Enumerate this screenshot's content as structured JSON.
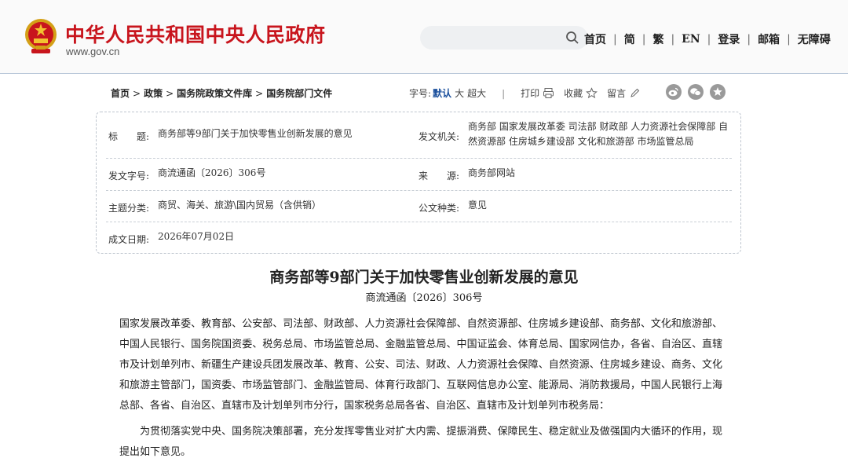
{
  "header": {
    "site_title": "中华人民共和国中央人民政府",
    "site_url": "www.gov.cn",
    "nav": [
      "首页",
      "简",
      "繁",
      "EN",
      "登录",
      "邮箱",
      "无障碍"
    ]
  },
  "breadcrumb": {
    "items": [
      "首页",
      "政策",
      "国务院政策文件库",
      "国务院部门文件"
    ],
    "separator": ">"
  },
  "tools": {
    "font_label": "字号:",
    "font_options": [
      "默认",
      "大",
      "超大"
    ],
    "print": "打印",
    "favorite": "收藏",
    "comment": "留言"
  },
  "info": {
    "title_label": "标　　题:",
    "title_value": "商务部等9部门关于加快零售业创新发展的意见",
    "issuer_label": "发文机关:",
    "issuer_value": "商务部 国家发展改革委 司法部 财政部 人力资源社会保障部 自然资源部 住房城乡建设部 文化和旅游部 市场监管总局",
    "docno_label": "发文字号:",
    "docno_value": "商流通函〔2026〕306号",
    "source_label": "来　　源:",
    "source_value": "商务部网站",
    "topic_label": "主题分类:",
    "topic_value": "商贸、海关、旅游\\国内贸易（含供销）",
    "doctype_label": "公文种类:",
    "doctype_value": "意见",
    "date_label": "成文日期:",
    "date_value": "2026年07月02日"
  },
  "article": {
    "title": "商务部等9部门关于加快零售业创新发展的意见",
    "docno": "商流通函〔2026〕306号",
    "addressees": "国家发展改革委、教育部、公安部、司法部、财政部、人力资源社会保障部、自然资源部、住房城乡建设部、商务部、文化和旅游部、中国人民银行、国务院国资委、税务总局、市场监管总局、金融监管总局、中国证监会、体育总局、国家网信办，各省、自治区、直辖市及计划单列市、新疆生产建设兵团发展改革、教育、公安、司法、财政、人力资源社会保障、自然资源、住房城乡建设、商务、文化和旅游主管部门，国资委、市场监管部门、金融监管局、体育行政部门、互联网信息办公室、能源局、消防救援局，中国人民银行上海总部、各省、自治区、直辖市及计划单列市分行，国家税务总局各省、自治区、直辖市及计划单列市税务局：",
    "intro": "　　为贯彻落实党中央、国务院决策部署，充分发挥零售业对扩大内需、提振消费、保障民生、稳定就业及做强国内大循环的作用，现提出如下意见。"
  }
}
